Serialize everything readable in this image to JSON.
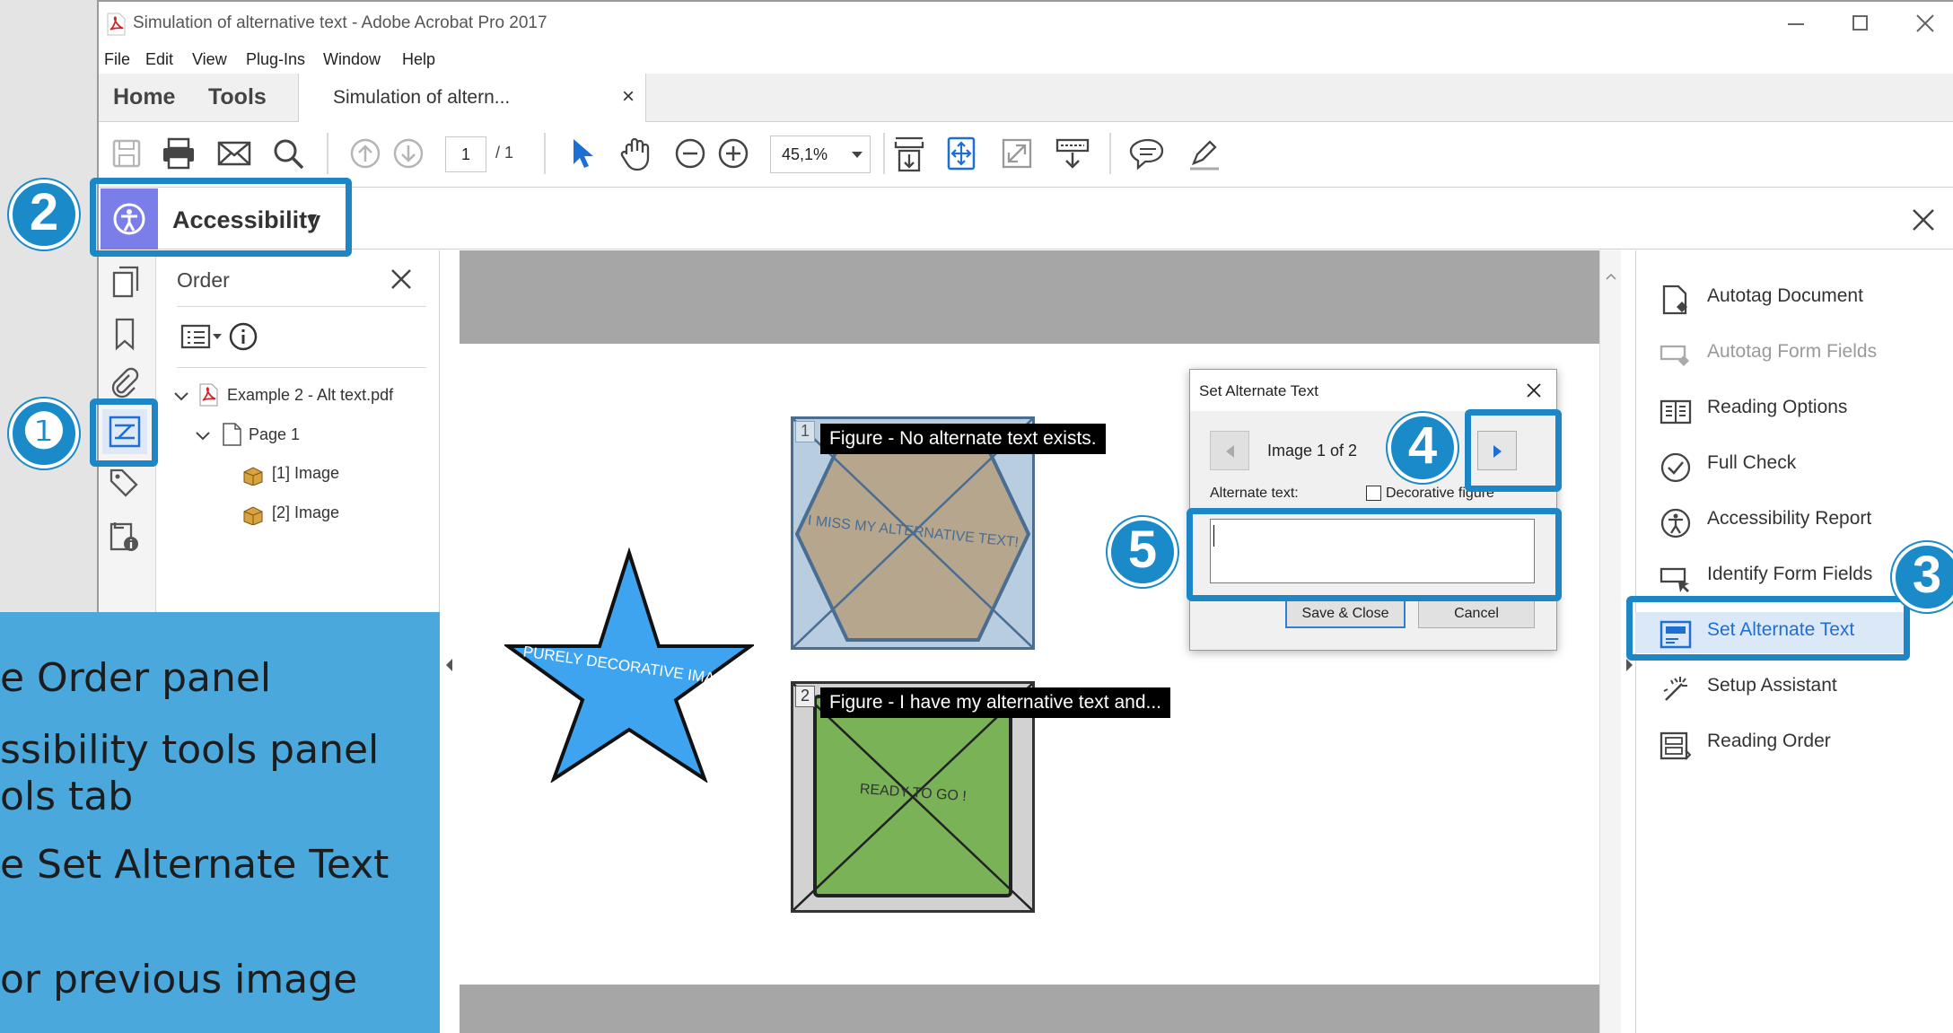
{
  "window": {
    "title": "Simulation of alternative text - Adobe Acrobat Pro 2017"
  },
  "menu": [
    "File",
    "Edit",
    "View",
    "Plug-Ins",
    "Window",
    "Help"
  ],
  "tabs": {
    "home": "Home",
    "tools": "Tools",
    "document": "Simulation of altern...",
    "close_glyph": "×"
  },
  "toolbar": {
    "page_current": "1",
    "page_total": "/ 1",
    "zoom": "45,1%"
  },
  "accessibility_bar": {
    "label": "Accessibility",
    "caret": "▾"
  },
  "order_panel": {
    "title": "Order",
    "tree": {
      "root": "Example 2 - Alt text.pdf",
      "page": "Page 1",
      "items": [
        "[1]  Image",
        "[2]  Image"
      ]
    }
  },
  "document": {
    "star_text": "PURELY DECORATIVE IMAGE",
    "figure1": {
      "number": "1",
      "tooltip": "Figure - No alternate text exists.",
      "inner_text": "I MISS MY ALTERNATIVE TEXT!"
    },
    "figure2": {
      "number": "2",
      "tooltip": "Figure - I have my alternative text and...",
      "inner_text": "READY TO GO !"
    }
  },
  "dialog": {
    "title": "Set Alternate Text",
    "counter": "Image 1 of 2",
    "alt_label": "Alternate text:",
    "decorative_label": "Decorative figure",
    "alt_value": "",
    "save_label": "Save & Close",
    "cancel_label": "Cancel"
  },
  "tools_panel": {
    "items": [
      {
        "label": "Autotag Document",
        "icon": "autotag-document-icon",
        "enabled": true
      },
      {
        "label": "Autotag Form Fields",
        "icon": "autotag-form-fields-icon",
        "enabled": false
      },
      {
        "label": "Reading Options",
        "icon": "reading-options-icon",
        "enabled": true
      },
      {
        "label": "Full Check",
        "icon": "full-check-icon",
        "enabled": true
      },
      {
        "label": "Accessibility Report",
        "icon": "accessibility-report-icon",
        "enabled": true
      },
      {
        "label": "Identify Form Fields",
        "icon": "identify-form-fields-icon",
        "enabled": true
      },
      {
        "label": "Set Alternate Text",
        "icon": "set-alternate-text-icon",
        "enabled": true,
        "active": true
      },
      {
        "label": "Setup Assistant",
        "icon": "setup-assistant-icon",
        "enabled": true
      },
      {
        "label": "Reading Order",
        "icon": "reading-order-icon",
        "enabled": true
      }
    ]
  },
  "badges": {
    "one": "❶",
    "two": "2",
    "three": "3",
    "four": "4",
    "five": "5"
  },
  "overlay": {
    "lines": [
      "e Order panel",
      "ssibility tools panel",
      "ols tab",
      "e Set Alternate Text",
      "  or previous image"
    ]
  },
  "colors": {
    "accent": "#1c86c6",
    "overlay_bg": "#4aa8dc",
    "accessibility_purple": "#7b7ee8",
    "star": "#3fa4ef",
    "figure1_fill": "#b6a68d",
    "figure2_fill": "#7ab258"
  }
}
